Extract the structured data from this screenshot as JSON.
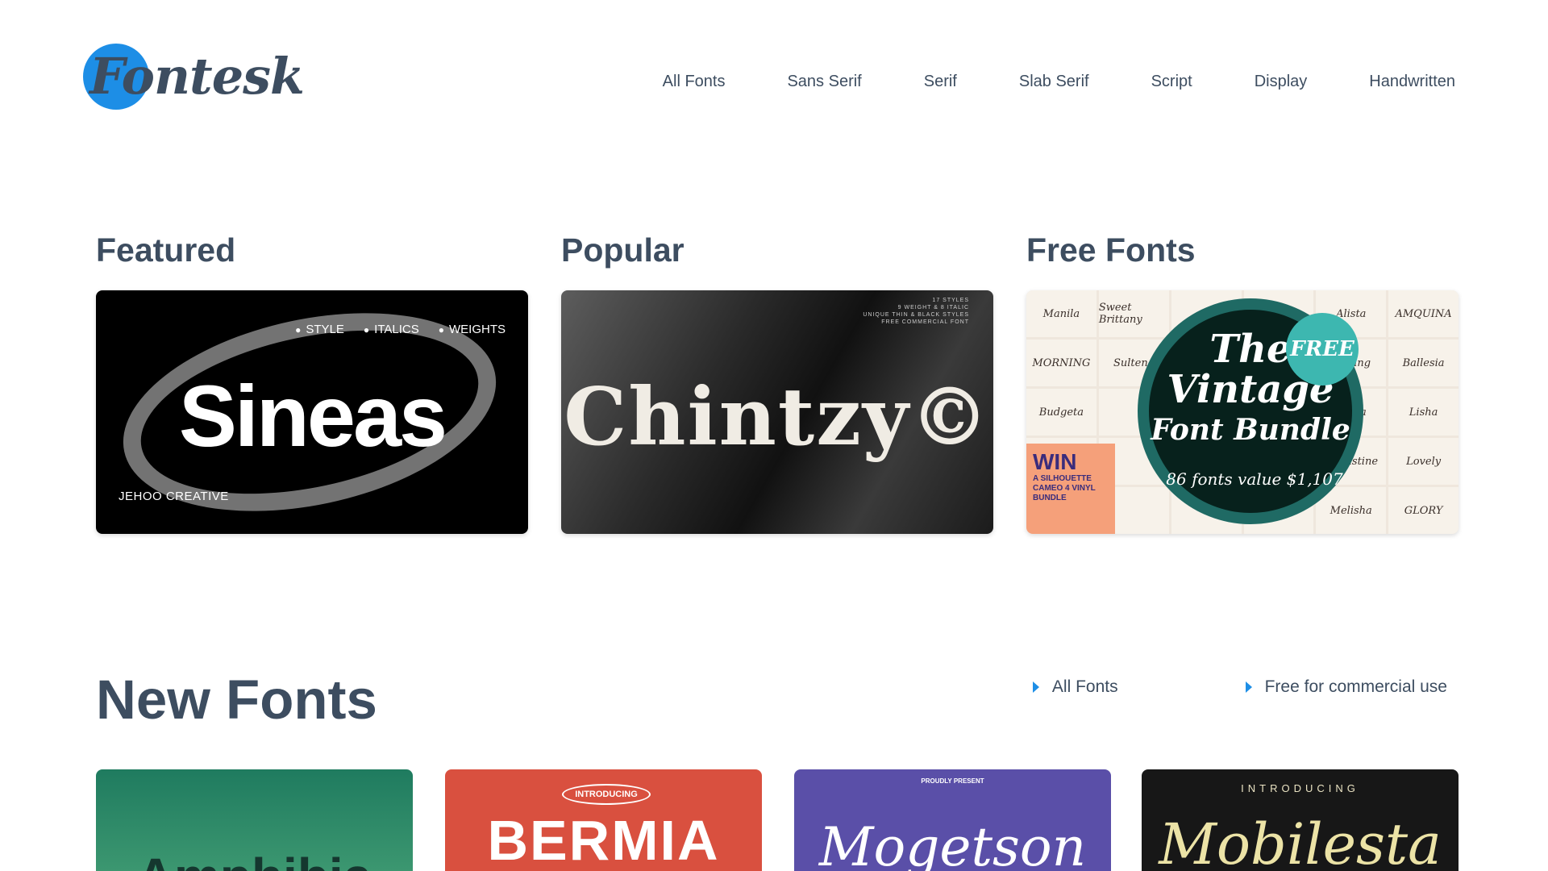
{
  "brand": {
    "logo_text": "Fontesk",
    "accent": "#1d8ee6",
    "text_color": "#3d4d60"
  },
  "nav": {
    "items": [
      {
        "label": "All Fonts"
      },
      {
        "label": "Sans Serif"
      },
      {
        "label": "Serif"
      },
      {
        "label": "Slab Serif"
      },
      {
        "label": "Script"
      },
      {
        "label": "Display"
      },
      {
        "label": "Handwritten"
      }
    ]
  },
  "sections": {
    "featured": {
      "title": "Featured",
      "card": {
        "name": "Sineas",
        "tags": [
          "STYLE",
          "ITALICS",
          "WEIGHTS"
        ],
        "credit": "JEHOO CREATIVE"
      }
    },
    "popular": {
      "title": "Popular",
      "card": {
        "name": "Chintzy©",
        "small_lines": [
          "17 STYLES",
          "9 WEIGHT & 8 ITALIC",
          "UNIQUE THIN & BLACK STYLES",
          "FREE COMMERCIAL FONT"
        ]
      }
    },
    "free_fonts": {
      "title": "Free Fonts",
      "card": {
        "line1": "The",
        "line2": "Vintage",
        "line3": "Font Bundle",
        "footer": "86 fonts  value $1,107",
        "badge": "FREE",
        "win_big": "WIN",
        "win_text": "A SILHOUETTE CAMEO 4 VINYL BUNDLE",
        "grid_names": [
          "Manila",
          "Sweet Brittany",
          "",
          "",
          "Alista",
          "AMQUINA",
          "MORNING",
          "Sultena",
          "",
          "",
          "Rafting",
          "Ballesia",
          "Budgeta",
          "",
          "",
          "",
          "Allina",
          "Lisha",
          "",
          "",
          "",
          "",
          "Augustine",
          "Lovely",
          "",
          "",
          "",
          "",
          "Melisha",
          "GLORY"
        ]
      }
    }
  },
  "new_fonts": {
    "title": "New Fonts",
    "links": [
      {
        "label": "All Fonts"
      },
      {
        "label": "Free for commercial use"
      }
    ],
    "cards": [
      {
        "pre": "",
        "name": "Amphibia"
      },
      {
        "pre": "INTRODUCING",
        "name": "BERMIA"
      },
      {
        "pre": "PROUDLY PRESENT",
        "name": "Mogetson"
      },
      {
        "pre": "INTRODUCING",
        "name": "Mobilesta"
      }
    ]
  }
}
